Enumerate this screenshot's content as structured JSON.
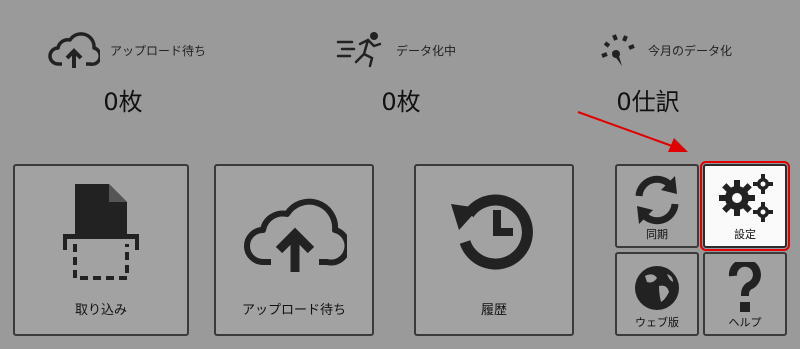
{
  "stats": [
    {
      "label": "アップロード待ち",
      "value": "0枚",
      "icon": "cloud-upload-icon"
    },
    {
      "label": "データ化中",
      "value": "0枚",
      "icon": "running-person-icon"
    },
    {
      "label": "今月のデータ化",
      "value": "0仕訳",
      "icon": "speedometer-icon"
    }
  ],
  "tiles": {
    "capture": {
      "label": "取り込み",
      "icon": "scan-document-icon"
    },
    "upload": {
      "label": "アップロード待ち",
      "icon": "cloud-upload-icon"
    },
    "history": {
      "label": "履歴",
      "icon": "history-icon"
    },
    "sync": {
      "label": "同期",
      "icon": "sync-icon"
    },
    "settings": {
      "label": "設定",
      "icon": "gears-icon"
    },
    "web": {
      "label": "ウェブ版",
      "icon": "globe-icon"
    },
    "help": {
      "label": "ヘルプ",
      "icon": "question-icon"
    }
  },
  "colors": {
    "background": "#9a9a9a",
    "highlight": "#e00000",
    "arrow": "#e00000"
  }
}
